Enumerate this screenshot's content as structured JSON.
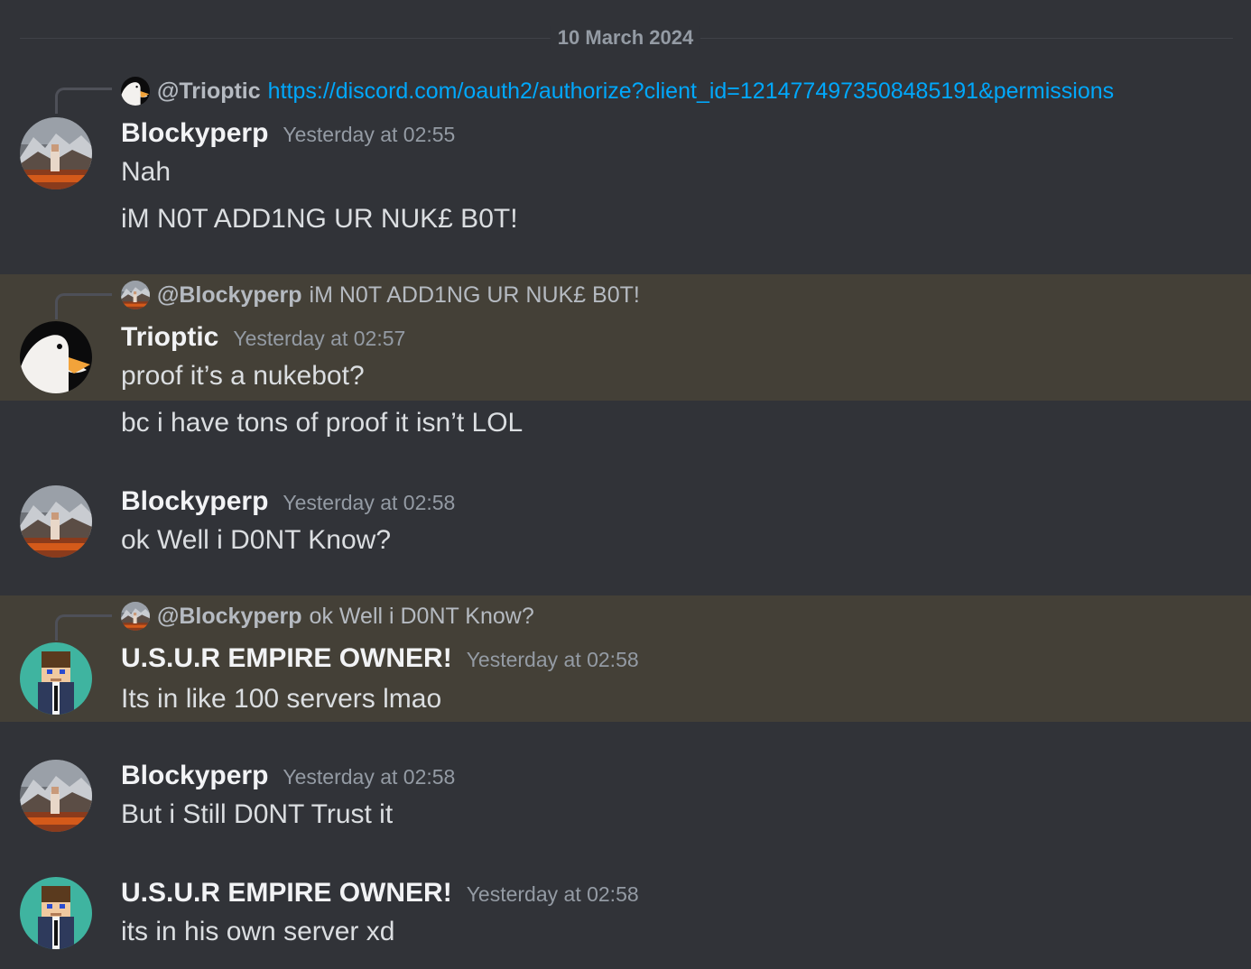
{
  "date_divider": "10 March 2024",
  "messages": [
    {
      "reply": {
        "user": "@Trioptic",
        "text": "https://discord.com/oauth2/authorize?client_id=1214774973508485191&permissions"
      },
      "author": "Blockyperp",
      "time": "Yesterday at 02:55",
      "lines": [
        "Nah",
        "iM N0T ADD1NG UR NUK£ B0T!"
      ]
    },
    {
      "reply": {
        "user": "@Blockyperp",
        "text": "iM N0T ADD1NG UR NUK£ B0T!"
      },
      "author": "Trioptic",
      "time": "Yesterday at 02:57",
      "lines": [
        "proof it’s a nukebot?",
        "bc i have tons of proof it isn’t LOL"
      ]
    },
    {
      "author": "Blockyperp",
      "time": "Yesterday at 02:58",
      "lines": [
        "ok Well i D0NT Know?"
      ]
    },
    {
      "reply": {
        "user": "@Blockyperp",
        "text": "ok Well i D0NT Know?"
      },
      "author": "U.S.U.R EMPIRE OWNER!",
      "time": "Yesterday at 02:58",
      "lines": [
        "Its in like 100 servers lmao"
      ]
    },
    {
      "author": "Blockyperp",
      "time": "Yesterday at 02:58",
      "lines": [
        "But i Still D0NT Trust it"
      ]
    },
    {
      "author": "U.S.U.R EMPIRE OWNER!",
      "time": "Yesterday at 02:58",
      "lines": [
        "its in his own server xd"
      ]
    }
  ],
  "colors": {
    "background": "#313338",
    "highlight": "#444037",
    "link": "#00a8fc",
    "username": "#f2f3f5",
    "timestamp": "#949ba4"
  },
  "icons": {
    "blockyperp": "mountain-landscape-avatar",
    "trioptic": "goose-avatar",
    "usur": "pixel-character-avatar"
  }
}
